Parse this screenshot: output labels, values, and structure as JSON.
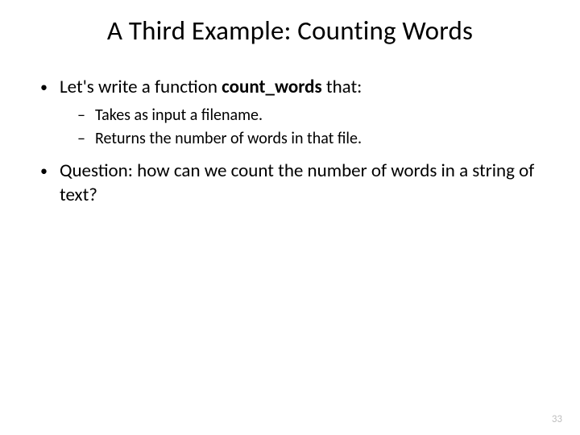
{
  "title": "A Third Example: Counting Words",
  "bullets": {
    "b1_pre": "Let's write a function ",
    "b1_bold": "count_words",
    "b1_post": " that:",
    "sub1": "Takes as input a filename.",
    "sub2": "Returns the number of words in that file.",
    "b2": "Question: how can we count the number of words in a string of text?"
  },
  "markers": {
    "dot": "•",
    "dash": "–"
  },
  "page_number": "33"
}
